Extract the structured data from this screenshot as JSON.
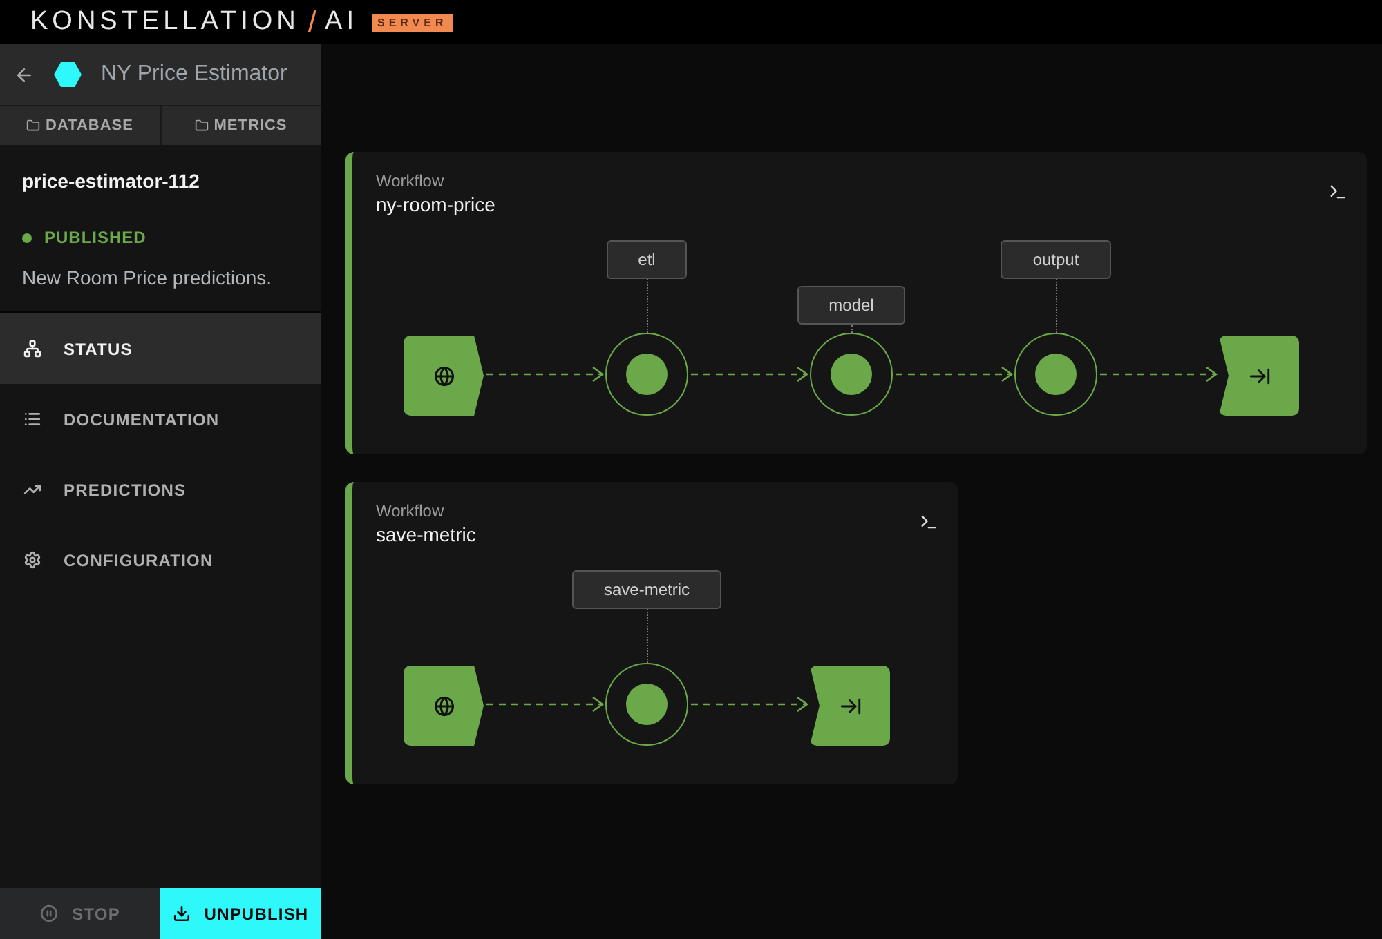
{
  "brand": {
    "name": "KONSTELLATION",
    "slash": "/",
    "suffix": "AI",
    "badge": "SERVER"
  },
  "project": {
    "title": "NY Price Estimator",
    "tabs": [
      {
        "label": "DATABASE"
      },
      {
        "label": "METRICS"
      }
    ]
  },
  "version": {
    "name": "price-estimator-112",
    "status": "PUBLISHED",
    "description": "New Room Price predictions."
  },
  "nav": [
    {
      "kind": "status",
      "label": "STATUS",
      "selected": true
    },
    {
      "kind": "documentation",
      "label": "DOCUMENTATION",
      "selected": false
    },
    {
      "kind": "predictions",
      "label": "PREDICTIONS",
      "selected": false
    },
    {
      "kind": "configuration",
      "label": "CONFIGURATION",
      "selected": false
    }
  ],
  "actions": [
    {
      "kind": "stop",
      "label": "STOP",
      "disabled": true
    },
    {
      "kind": "unpublish",
      "label": "UNPUBLISH",
      "disabled": false
    }
  ],
  "workflows": [
    {
      "label": "Workflow",
      "name": "ny-room-price",
      "nodes": [
        {
          "kind": "input"
        },
        {
          "kind": "step",
          "label": "etl"
        },
        {
          "kind": "step",
          "label": "model"
        },
        {
          "kind": "step",
          "label": "output"
        },
        {
          "kind": "output"
        }
      ]
    },
    {
      "label": "Workflow",
      "name": "save-metric",
      "nodes": [
        {
          "kind": "input"
        },
        {
          "kind": "step",
          "label": "save-metric"
        },
        {
          "kind": "output"
        }
      ]
    }
  ]
}
